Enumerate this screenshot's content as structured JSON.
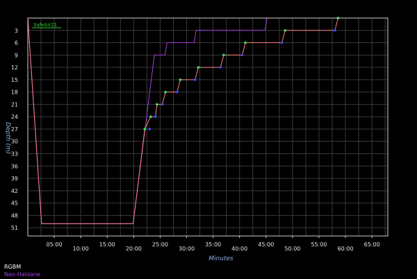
{
  "chart_data": {
    "type": "line",
    "xlabel": "Minutes",
    "ylabel": "Depth (m)",
    "xlim": [
      0,
      68
    ],
    "ylim": [
      0,
      53
    ],
    "y_inverted": true,
    "grid": true,
    "x_ticks": [
      5,
      10,
      15,
      20,
      25,
      30,
      35,
      40,
      45,
      50,
      55,
      60,
      65
    ],
    "x_tick_labels": [
      "05:00",
      "10:00",
      "15:00",
      "20:00",
      "25:00",
      "30:00",
      "35:00",
      "40:00",
      "45:00",
      "50:00",
      "55:00",
      "60:00",
      "65:00"
    ],
    "y_ticks": [
      3,
      6,
      9,
      12,
      15,
      18,
      21,
      24,
      27,
      30,
      33,
      36,
      39,
      42,
      45,
      48,
      51
    ],
    "y_tick_labels": [
      "3",
      "6",
      "9",
      "12",
      "15",
      "18",
      "21",
      "24",
      "27",
      "30",
      "33",
      "36",
      "39",
      "42",
      "45",
      "48",
      "51"
    ],
    "inline_legend": "SafeAir21",
    "series": [
      {
        "name": "RGBM",
        "color": "#ff8080",
        "points": [
          [
            0,
            0
          ],
          [
            2.6,
            50
          ],
          [
            19.9,
            50
          ],
          [
            22.1,
            27
          ],
          [
            23.2,
            24
          ],
          [
            24.1,
            24
          ],
          [
            24.4,
            21
          ],
          [
            25.4,
            21
          ],
          [
            26,
            18
          ],
          [
            28.2,
            18
          ],
          [
            28.8,
            15
          ],
          [
            31.6,
            15
          ],
          [
            32.2,
            12
          ],
          [
            36.4,
            12
          ],
          [
            37,
            9
          ],
          [
            40.5,
            9
          ],
          [
            41.1,
            6
          ],
          [
            48,
            6
          ],
          [
            48.6,
            3
          ],
          [
            58,
            3
          ],
          [
            58.6,
            0
          ]
        ],
        "markers_green": [
          [
            22.1,
            27
          ],
          [
            23.2,
            24
          ],
          [
            24.4,
            21
          ],
          [
            26,
            18
          ],
          [
            28.8,
            15
          ],
          [
            32.2,
            12
          ],
          [
            37,
            9
          ],
          [
            41.1,
            6
          ],
          [
            48.6,
            3
          ],
          [
            58.6,
            0
          ]
        ],
        "markers_blue": [
          [
            23,
            27
          ],
          [
            24.1,
            24
          ],
          [
            25.4,
            21
          ],
          [
            28.2,
            18
          ],
          [
            31.6,
            15
          ],
          [
            36.4,
            12
          ],
          [
            40.5,
            9
          ],
          [
            48,
            6
          ],
          [
            58,
            3
          ]
        ]
      },
      {
        "name": "Neo-Haldane",
        "color": "#a040e0",
        "points": [
          [
            0,
            0
          ],
          [
            2.6,
            50
          ],
          [
            19.9,
            50
          ],
          [
            23.9,
            9
          ],
          [
            25.9,
            9
          ],
          [
            26.3,
            6
          ],
          [
            31.4,
            6
          ],
          [
            31.8,
            3
          ],
          [
            44.8,
            3
          ],
          [
            45.2,
            0
          ]
        ]
      }
    ]
  },
  "legend": {
    "rgbm_label": "RGBM",
    "rgbm_color": "#ffffff",
    "neo_label": "Neo-Haldane",
    "neo_color": "#a040e0"
  }
}
